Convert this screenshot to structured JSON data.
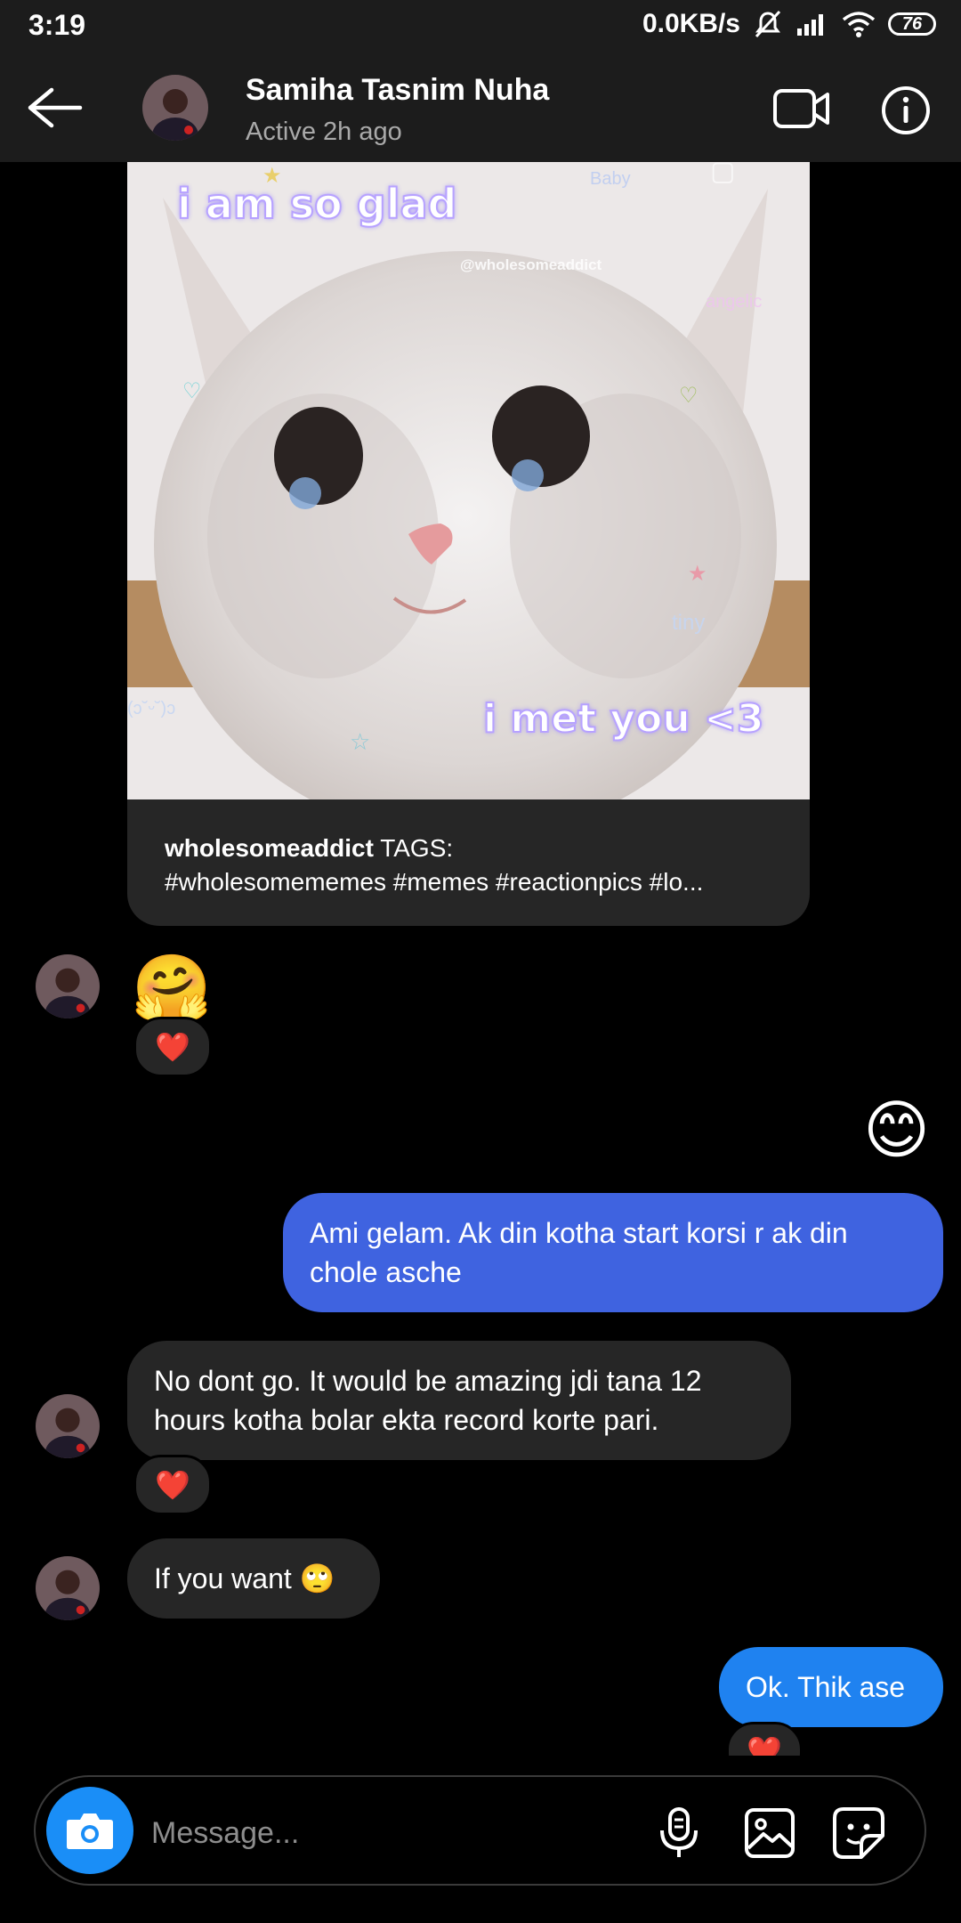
{
  "status_bar": {
    "time": "3:19",
    "network_speed": "0.0KB/s",
    "battery": "76"
  },
  "header": {
    "contact_name": "Samiha Tasnim Nuha",
    "contact_status": "Active 2h ago"
  },
  "shared_post": {
    "image_text_top": "i am so glad",
    "image_text_bottom": "i met you <3",
    "image_watermark": "@wholesomeaddict",
    "username": "wholesomeaddict",
    "caption_label": "TAGS:",
    "caption_tags": "#wholesomememes #memes #reactionpics #lo..."
  },
  "messages": [
    {
      "sender": "contact",
      "text": "🤗",
      "reaction": "❤️"
    },
    {
      "sender": "me",
      "text": "😊"
    },
    {
      "sender": "me",
      "text": "Ami gelam. Ak din kotha start korsi r ak din chole asche"
    },
    {
      "sender": "contact",
      "text": "No dont go. It would be amazing jdi tana 12 hours kotha bolar ekta record korte pari.",
      "reaction": "❤️"
    },
    {
      "sender": "contact",
      "text": "If you want 🙄"
    },
    {
      "sender": "me",
      "text": "Ok. Thik ase",
      "reaction": "❤️"
    }
  ],
  "composer": {
    "placeholder": "Message..."
  },
  "colors": {
    "outgoing_bubble": "#3f63e0",
    "outgoing_bubble_latest": "#1f82f0",
    "incoming_bubble": "#262626",
    "camera_button": "#1a8ef7"
  }
}
